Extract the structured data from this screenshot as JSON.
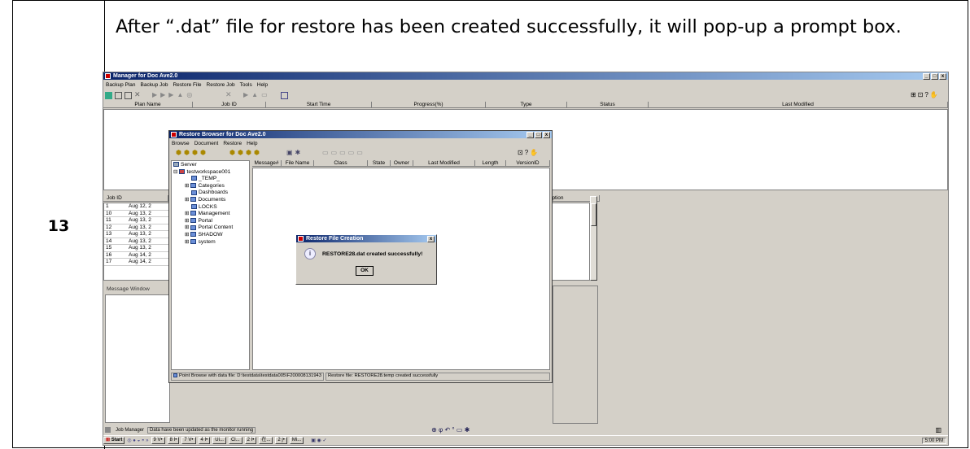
{
  "step_number": "13",
  "instruction": "After “.dat” file for restore has been created successfully, it will pop-up a prompt box.",
  "manager": {
    "title": "Manager for Doc Ave2.0",
    "menus": [
      "Backup Plan",
      "Backup Job",
      "Restore File",
      "Restore Job",
      "Tools",
      "Help"
    ],
    "columns": [
      "Plan Name",
      "Job ID",
      "Start Time",
      "Progress(%)",
      "Type",
      "Status",
      "Last Modified"
    ],
    "jobs_header": "Job ID",
    "jobs_right_header": "iption",
    "jobs": [
      {
        "id": "1",
        "date": "Aug 12, 2"
      },
      {
        "id": "10",
        "date": "Aug 13, 2"
      },
      {
        "id": "11",
        "date": "Aug 13, 2"
      },
      {
        "id": "12",
        "date": "Aug 13, 2"
      },
      {
        "id": "13",
        "date": "Aug 13, 2"
      },
      {
        "id": "14",
        "date": "Aug 13, 2"
      },
      {
        "id": "15",
        "date": "Aug 13, 2"
      },
      {
        "id": "16",
        "date": "Aug 14, 2"
      },
      {
        "id": "17",
        "date": "Aug 14, 2"
      }
    ],
    "message_window": "Message Window",
    "status_label": "Job Manager",
    "status_text": "Data have been updated as the monitor running"
  },
  "browser": {
    "title": "Restore Browser for Doc Ave2.0",
    "menus": [
      "Browse",
      "Document",
      "Restore",
      "Help"
    ],
    "tree_root": "Server",
    "workspace": "testworkspace001",
    "tree_items": [
      "_TEMP_",
      "Categories",
      "Dashboards",
      "Documents",
      "LOCKS",
      "Management",
      "Portal",
      "Portal Content",
      "SHADOW",
      "system"
    ],
    "columns": [
      "Message#",
      "File Name",
      "Class",
      "State",
      "Owner",
      "Last Modified",
      "Length",
      "VersionID"
    ],
    "status_left": "Point Browse with data file: D:\\testdata\\testdata005\\F200008131943",
    "status_right": "Restore file: RESTORE28.temp created successfully"
  },
  "dialog": {
    "title": "Restore File Creation",
    "message": "RESTORE28.dat created successfully!",
    "ok_label": "OK"
  },
  "taskbar": {
    "start_label": "Start",
    "items": [
      "9 V•",
      "8 I•",
      "7 V•",
      "4 I•",
      "Ui...",
      "Cl...",
      "2 I•",
      "在...",
      "2 j•",
      "Mi..."
    ],
    "clock": "5:00 PM"
  },
  "colors": {
    "title_dark": "#0a246a",
    "title_light": "#a6caf0",
    "window_bg": "#d4d0c8"
  }
}
